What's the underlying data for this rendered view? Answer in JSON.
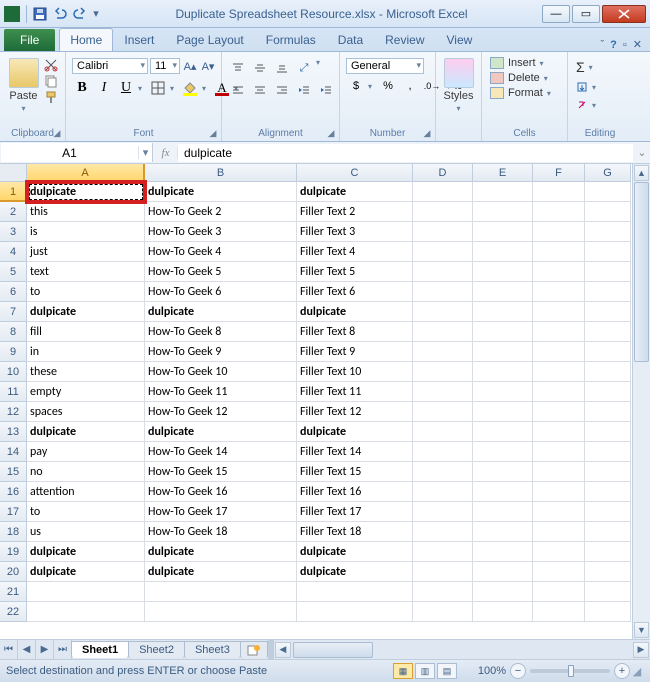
{
  "app": {
    "title": "Duplicate Spreadsheet Resource.xlsx  -  Microsoft Excel"
  },
  "tabs": {
    "file": "File",
    "list": [
      "Home",
      "Insert",
      "Page Layout",
      "Formulas",
      "Data",
      "Review",
      "View"
    ],
    "active": "Home"
  },
  "ribbon": {
    "clipboard": {
      "label": "Clipboard",
      "paste": "Paste"
    },
    "font": {
      "label": "Font",
      "name": "Calibri",
      "size": "11"
    },
    "alignment": {
      "label": "Alignment",
      "wrap": "Wrap Text",
      "merge": "Merge & Center"
    },
    "number": {
      "label": "Number",
      "format": "General"
    },
    "styles": {
      "label": "Styles",
      "btn": "Styles"
    },
    "cells": {
      "label": "Cells",
      "insert": "Insert",
      "delete": "Delete",
      "format": "Format"
    },
    "editing": {
      "label": "Editing"
    }
  },
  "formula_bar": {
    "namebox": "A1",
    "value": "dulpicate"
  },
  "columns": [
    "A",
    "B",
    "C",
    "D",
    "E",
    "F",
    "G"
  ],
  "col_widths": [
    "cA",
    "cB",
    "cC",
    "cD",
    "cE",
    "cF",
    "cG"
  ],
  "selected_col": "A",
  "selected_row": 1,
  "rows": [
    {
      "n": 1,
      "bold": true,
      "cells": [
        "dulpicate",
        "dulpicate",
        "dulpicate",
        "",
        "",
        "",
        ""
      ]
    },
    {
      "n": 2,
      "bold": false,
      "cells": [
        "this",
        "How-To Geek  2",
        "Filler Text 2",
        "",
        "",
        "",
        ""
      ]
    },
    {
      "n": 3,
      "bold": false,
      "cells": [
        "is",
        "How-To Geek  3",
        "Filler Text 3",
        "",
        "",
        "",
        ""
      ]
    },
    {
      "n": 4,
      "bold": false,
      "cells": [
        "just",
        "How-To Geek  4",
        "Filler Text 4",
        "",
        "",
        "",
        ""
      ]
    },
    {
      "n": 5,
      "bold": false,
      "cells": [
        "text",
        "How-To Geek  5",
        "Filler Text 5",
        "",
        "",
        "",
        ""
      ]
    },
    {
      "n": 6,
      "bold": false,
      "cells": [
        "to",
        "How-To Geek  6",
        "Filler Text 6",
        "",
        "",
        "",
        ""
      ]
    },
    {
      "n": 7,
      "bold": true,
      "cells": [
        "dulpicate",
        "dulpicate",
        "dulpicate",
        "",
        "",
        "",
        ""
      ]
    },
    {
      "n": 8,
      "bold": false,
      "cells": [
        "fill",
        "How-To Geek  8",
        "Filler Text 8",
        "",
        "",
        "",
        ""
      ]
    },
    {
      "n": 9,
      "bold": false,
      "cells": [
        "in",
        "How-To Geek  9",
        "Filler Text 9",
        "",
        "",
        "",
        ""
      ]
    },
    {
      "n": 10,
      "bold": false,
      "cells": [
        "these",
        "How-To Geek  10",
        "Filler Text 10",
        "",
        "",
        "",
        ""
      ]
    },
    {
      "n": 11,
      "bold": false,
      "cells": [
        "empty",
        "How-To Geek  11",
        "Filler Text 11",
        "",
        "",
        "",
        ""
      ]
    },
    {
      "n": 12,
      "bold": false,
      "cells": [
        "spaces",
        "How-To Geek  12",
        "Filler Text 12",
        "",
        "",
        "",
        ""
      ]
    },
    {
      "n": 13,
      "bold": true,
      "cells": [
        "dulpicate",
        "dulpicate",
        "dulpicate",
        "",
        "",
        "",
        ""
      ]
    },
    {
      "n": 14,
      "bold": false,
      "cells": [
        "pay",
        "How-To Geek  14",
        "Filler Text 14",
        "",
        "",
        "",
        ""
      ]
    },
    {
      "n": 15,
      "bold": false,
      "cells": [
        "no",
        "How-To Geek  15",
        "Filler Text 15",
        "",
        "",
        "",
        ""
      ]
    },
    {
      "n": 16,
      "bold": false,
      "cells": [
        "attention",
        "How-To Geek  16",
        "Filler Text 16",
        "",
        "",
        "",
        ""
      ]
    },
    {
      "n": 17,
      "bold": false,
      "cells": [
        "to",
        "How-To Geek  17",
        "Filler Text 17",
        "",
        "",
        "",
        ""
      ]
    },
    {
      "n": 18,
      "bold": false,
      "cells": [
        "us",
        "How-To Geek  18",
        "Filler Text 18",
        "",
        "",
        "",
        ""
      ]
    },
    {
      "n": 19,
      "bold": true,
      "cells": [
        "dulpicate",
        "dulpicate",
        "dulpicate",
        "",
        "",
        "",
        ""
      ]
    },
    {
      "n": 20,
      "bold": true,
      "cells": [
        "dulpicate",
        "dulpicate",
        "dulpicate",
        "",
        "",
        "",
        ""
      ]
    },
    {
      "n": 21,
      "bold": false,
      "cells": [
        "",
        "",
        "",
        "",
        "",
        "",
        ""
      ]
    },
    {
      "n": 22,
      "bold": false,
      "cells": [
        "",
        "",
        "",
        "",
        "",
        "",
        ""
      ]
    }
  ],
  "sheets": {
    "list": [
      "Sheet1",
      "Sheet2",
      "Sheet3"
    ],
    "active": "Sheet1"
  },
  "status": {
    "msg": "Select destination and press ENTER or choose Paste",
    "zoom": "100%"
  }
}
